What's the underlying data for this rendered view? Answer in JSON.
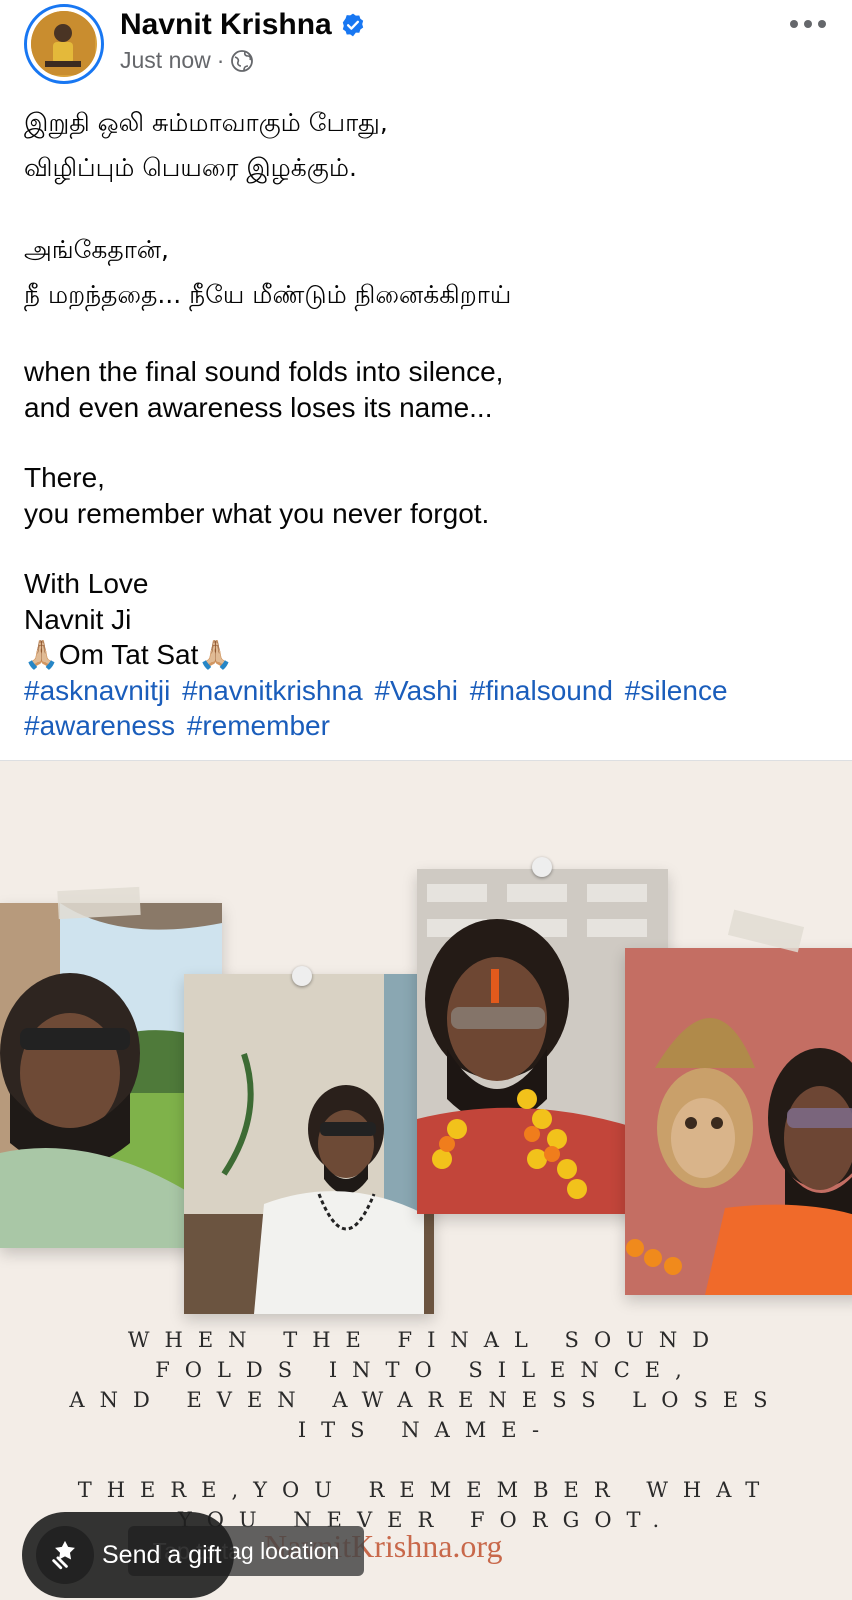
{
  "post": {
    "author": "Navnit Krishna",
    "timestamp": "Just now",
    "separator": "·",
    "privacy_icon": "globe-icon",
    "verified_icon": "verified-badge-icon",
    "more_icon": "more-dots-icon"
  },
  "text": {
    "tamil_line1": "இறுதி ஒலி சும்மாவாகும் போது,",
    "tamil_line2": "விழிப்பும் பெயரை இழக்கும்.",
    "tamil_line3": "அங்கேதான்,",
    "tamil_line4": "நீ மறந்ததை... நீயே மீண்டும் நினைக்கிறாய்",
    "en_line1": "when the final sound folds into silence,",
    "en_line2": "and even awareness loses its name...",
    "en_line3": "There,",
    "en_line4": "you remember what you never forgot.",
    "sign1": "With Love",
    "sign2": "Navnit Ji",
    "sign3": "🙏🏼Om Tat Sat🙏🏼"
  },
  "hashtags": [
    "#asknavnitji",
    "#navnitkrishna",
    "#Vashi",
    "#finalsound",
    "#silence",
    "#awareness",
    "#remember"
  ],
  "image": {
    "caption_line1": "WHEN THE FINAL SOUND",
    "caption_line2": "FOLDS INTO SILENCE,",
    "caption_line3": "AND EVEN AWARENESS LOSES",
    "caption_line4": "ITS NAME-",
    "caption_line5": "THERE,YOU REMEMBER WHAT",
    "caption_line6": "YOU NEVER FORGOT.",
    "website": "NavnitKrishna.org"
  },
  "overlays": {
    "gift_label": "Send a gift",
    "gift_icon": "gift-icon",
    "tag_label": "Tap to tag location"
  },
  "colors": {
    "accent": "#1877f2",
    "hashtag": "#1a5dbb",
    "meta": "#65676b",
    "image_bg": "#f3ede7",
    "site_text": "#c8684a"
  }
}
